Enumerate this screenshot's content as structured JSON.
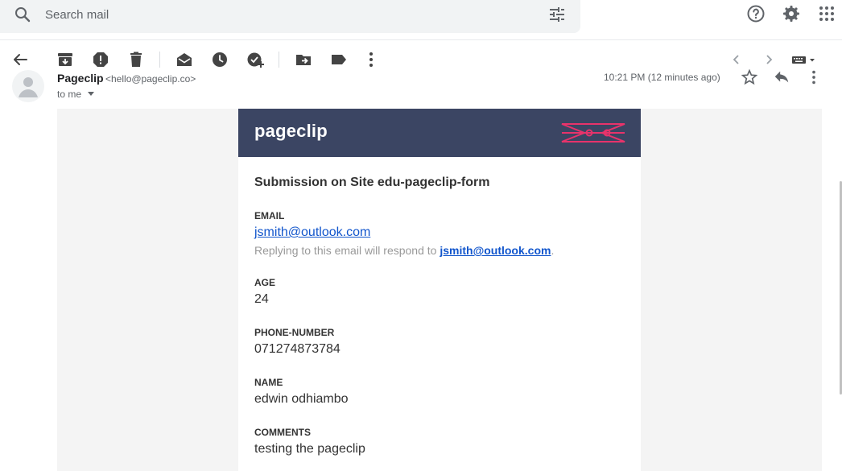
{
  "search": {
    "placeholder": "Search mail"
  },
  "icons": {
    "search": "search-icon",
    "filter": "tune-icon",
    "help": "help-icon",
    "settings": "gear-icon",
    "apps": "apps-grid-icon",
    "back": "arrow-back-icon",
    "archive": "archive-icon",
    "spam": "report-spam-icon",
    "delete": "trash-icon",
    "unread": "mark-unread-icon",
    "snooze": "clock-icon",
    "task": "add-task-icon",
    "move": "move-to-icon",
    "label": "label-icon",
    "more": "more-vert-icon",
    "prev": "chevron-left-icon",
    "next": "chevron-right-icon",
    "keyboard": "keyboard-icon",
    "star": "star-icon",
    "reply": "reply-icon"
  },
  "message": {
    "sender": "Pageclip",
    "sender_email": "<hello@pageclip.co>",
    "to": "to me",
    "time": "10:21 PM (12 minutes ago)"
  },
  "email": {
    "brand": "pageclip",
    "title": "Submission on Site edu-pageclip-form",
    "fields": [
      {
        "label": "EMAIL",
        "value": "jsmith@outlook.com"
      },
      {
        "label": "AGE",
        "value": "24"
      },
      {
        "label": "PHONE-NUMBER",
        "value": "071274873784"
      },
      {
        "label": "NAME",
        "value": "edwin odhiambo"
      },
      {
        "label": "COMMENTS",
        "value": "testing the pageclip"
      }
    ],
    "reply_prefix": "Replying to this email will respond to ",
    "reply_email": "jsmith@outlook.com",
    "reply_suffix": "."
  },
  "colors": {
    "brand_bar": "#3b4563",
    "brand_accent": "#e8336b",
    "link": "#1155cc",
    "page_bg": "#f4f4f4"
  }
}
